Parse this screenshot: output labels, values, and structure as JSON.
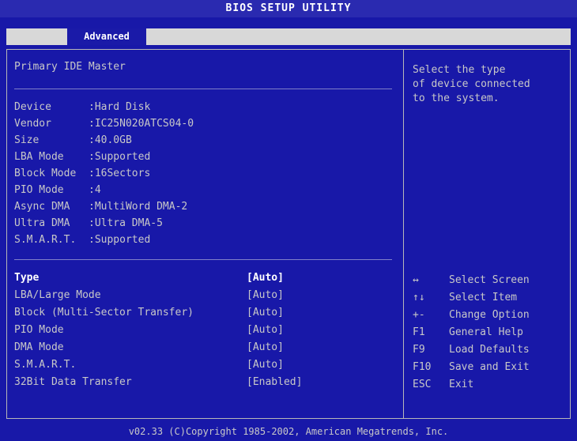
{
  "title": "BIOS SETUP UTILITY",
  "tabs": [
    {
      "label": "Advanced",
      "active": true
    }
  ],
  "heading": "Primary IDE Master",
  "device_info": [
    {
      "label": "Device",
      "value": ":Hard Disk"
    },
    {
      "label": "Vendor",
      "value": ":IC25N020ATCS04-0"
    },
    {
      "label": "Size",
      "value": ":40.0GB"
    },
    {
      "label": "LBA Mode",
      "value": ":Supported"
    },
    {
      "label": "Block Mode",
      "value": ":16Sectors"
    },
    {
      "label": "PIO Mode",
      "value": ":4"
    },
    {
      "label": "Async DMA",
      "value": ":MultiWord DMA-2"
    },
    {
      "label": "Ultra DMA",
      "value": ":Ultra DMA-5"
    },
    {
      "label": "S.M.A.R.T.",
      "value": ":Supported"
    }
  ],
  "options": [
    {
      "label": "Type",
      "value": "[Auto]"
    },
    {
      "label": "LBA/Large Mode",
      "value": "[Auto]"
    },
    {
      "label": "Block (Multi-Sector Transfer)",
      "value": "[Auto]"
    },
    {
      "label": "PIO Mode",
      "value": "[Auto]"
    },
    {
      "label": "DMA Mode",
      "value": "[Auto]"
    },
    {
      "label": "S.M.A.R.T.",
      "value": "[Auto]"
    },
    {
      "label": "32Bit Data Transfer",
      "value": "[Enabled]"
    }
  ],
  "help_text": "Select the type\nof device connected\nto the system.",
  "key_legend": [
    {
      "key": "↔",
      "action": "Select Screen"
    },
    {
      "key": "↑↓",
      "action": "Select Item"
    },
    {
      "key": "+-",
      "action": "Change Option"
    },
    {
      "key": "F1",
      "action": "General Help"
    },
    {
      "key": "F9",
      "action": "Load Defaults"
    },
    {
      "key": "F10",
      "action": "Save and Exit"
    },
    {
      "key": "ESC",
      "action": "Exit"
    }
  ],
  "footer": "v02.33 (C)Copyright 1985-2002, American Megatrends, Inc.",
  "colors": {
    "background": "#1818a8",
    "text": "#c8c8c8",
    "highlight": "#ffffff",
    "tab_bar": "#d8d8d8"
  }
}
